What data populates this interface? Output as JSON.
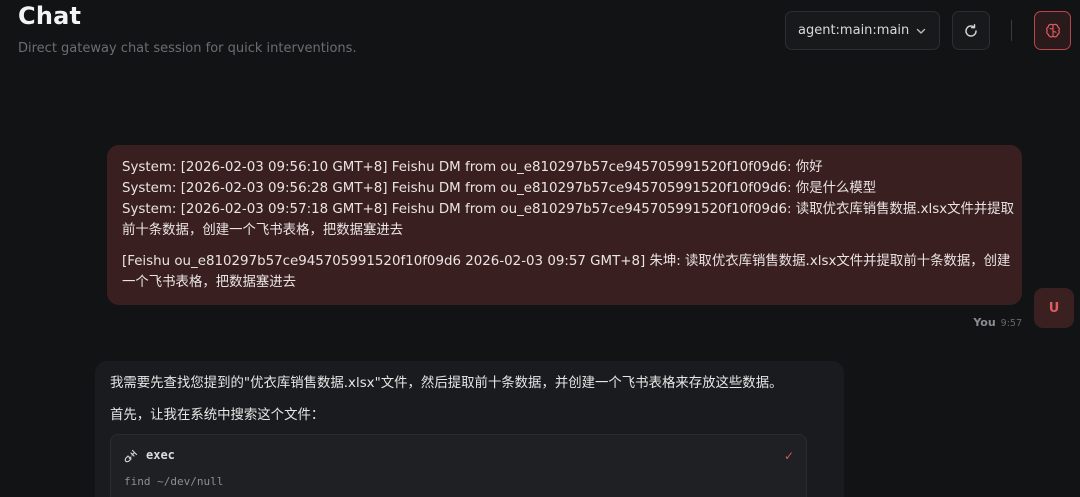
{
  "header": {
    "title": "Chat",
    "subtitle": "Direct gateway chat session for quick interventions.",
    "session_value": "agent:main:main",
    "icons": {
      "chevron": "chevron-down-icon",
      "refresh": "refresh-icon",
      "brain": "brain-icon"
    }
  },
  "user_message": {
    "lines": [
      "System: [2026-02-03 09:56:10 GMT+8] Feishu DM from ou_e810297b57ce945705991520f10f09d6: 你好",
      "System: [2026-02-03 09:56:28 GMT+8] Feishu DM from ou_e810297b57ce945705991520f10f09d6: 你是什么模型",
      "System: [2026-02-03 09:57:18 GMT+8] Feishu DM from ou_e810297b57ce945705991520f10f09d6: 读取优衣库销售数据.xlsx文件并提取",
      "前十条数据，创建一个飞书表格，把数据塞进去"
    ],
    "lines2": [
      "[Feishu ou_e810297b57ce945705991520f10f09d6 2026-02-03 09:57 GMT+8] 朱坤: 读取优衣库销售数据.xlsx文件并提取前十条数据，创建",
      "一个飞书表格，把数据塞进去"
    ],
    "sender": "You",
    "time": "9:57",
    "avatar_letter": "U"
  },
  "assistant_message": {
    "paragraph1": "我需要先查找您提到的\"优衣库销售数据.xlsx\"文件，然后提取前十条数据，并创建一个飞书表格来存放这些数据。",
    "paragraph2": "首先，让我在系统中搜索这个文件：",
    "tool": {
      "name": "exec",
      "command": "find ~/dev/null",
      "status_icon": "check-icon"
    }
  },
  "colors": {
    "background": "#121314",
    "user_bubble": "#3a1f20",
    "assistant_bubble": "#1a1b1e",
    "accent": "#e05b5f"
  }
}
